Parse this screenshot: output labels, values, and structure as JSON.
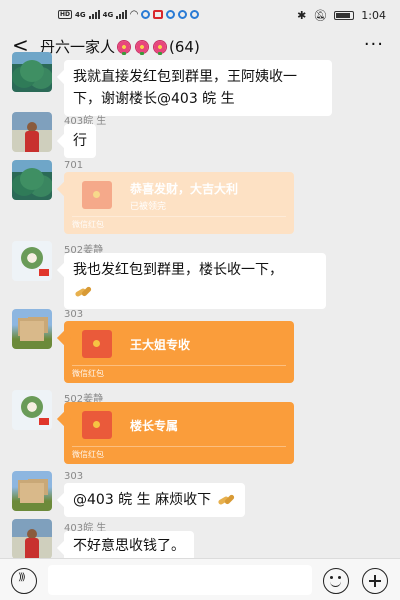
{
  "status_bar": {
    "sim_labels": [
      "HD",
      "HD"
    ],
    "network": [
      "4G",
      "4G"
    ],
    "time": "1:04",
    "battery_level": 0.85,
    "icons": [
      "signal-icon",
      "wifi-icon",
      "bluetooth-icon",
      "mute-icon",
      "battery-icon"
    ]
  },
  "header": {
    "back_icon": "chevron-left-icon",
    "title": "丹六一家人",
    "title_emojis": [
      "flower-icon",
      "flower-icon",
      "flower-icon"
    ],
    "member_count": "(64)",
    "more_icon": "more-dots-icon"
  },
  "messages": [
    {
      "type": "text",
      "sender": "",
      "avatar": "tree-avatar",
      "text": "我就直接发红包到群里，王阿姨收一下，谢谢楼长@403 皖 生"
    },
    {
      "type": "text",
      "sender": "403皖 生",
      "avatar": "person-avatar",
      "text": "行"
    },
    {
      "type": "red_packet",
      "sender": "701",
      "avatar": "tree-avatar",
      "title": "恭喜发财，大吉大利",
      "status": "已被领完",
      "footer": "微信红包",
      "opened": true
    },
    {
      "type": "text",
      "sender": "502姜静",
      "avatar": "flower-avatar",
      "text": "我也发红包到群里，楼长收一下，",
      "emoji": "clap-icon"
    },
    {
      "type": "red_packet",
      "sender": "303",
      "avatar": "castle-avatar",
      "title": "王大姐专收",
      "status": "",
      "footer": "微信红包",
      "opened": false
    },
    {
      "type": "red_packet",
      "sender": "502姜静",
      "avatar": "flower-avatar",
      "title": "楼长专属",
      "status": "",
      "footer": "微信红包",
      "opened": false
    },
    {
      "type": "text",
      "sender": "303",
      "avatar": "castle-avatar",
      "text": "@403 皖 生  麻烦收下",
      "emoji": "clap-icon"
    },
    {
      "type": "text",
      "sender": "403皖 生",
      "avatar": "person-avatar",
      "text": "不好意思收钱了。"
    }
  ],
  "input_bar": {
    "voice_icon": "voice-icon",
    "input_value": "",
    "emoji_icon": "emoji-icon",
    "plus_icon": "plus-icon"
  },
  "colors": {
    "background": "#ededed",
    "red_packet": "#fa9d3b",
    "red_packet_opened": "#fde1c4"
  }
}
